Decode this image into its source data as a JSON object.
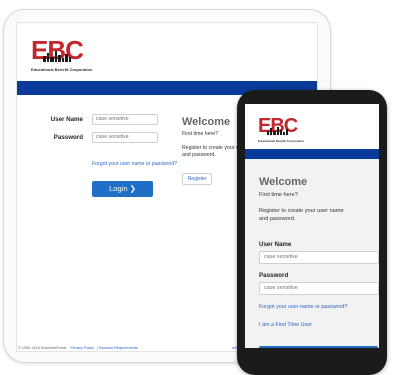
{
  "brand": {
    "logo_text": "EBC",
    "tagline": "Educational Benefit Corporation",
    "logo_color": "#c1272d",
    "bar_color": "#0a3a9a"
  },
  "tablet": {
    "form": {
      "username_label": "User Name",
      "username_placeholder": "case sensitive",
      "password_label": "Password",
      "password_placeholder": "case sensitive",
      "forgot_link": "Forgot your user name or password?",
      "login_button": "Login ❯"
    },
    "welcome": {
      "title": "Welcome",
      "first_time": "First time here?",
      "register_text": "Register to create your user name and password.",
      "register_button": "Register"
    },
    "footer": {
      "copyright": "© 1995-2016 BusinessPortal",
      "privacy": "Privacy Policy",
      "browser": "| Browser Requirements",
      "right_link": "wingEBC"
    }
  },
  "phone": {
    "welcome_title": "Welcome",
    "first_time": "First time here?",
    "register_text": "Register to create your user name and password.",
    "username_label": "User Name",
    "username_placeholder": "case sensitive",
    "password_label": "Password",
    "password_placeholder": "case sensitive",
    "forgot_link": "Forgot your user name or password?",
    "first_time_link": "I am a First Time User"
  }
}
